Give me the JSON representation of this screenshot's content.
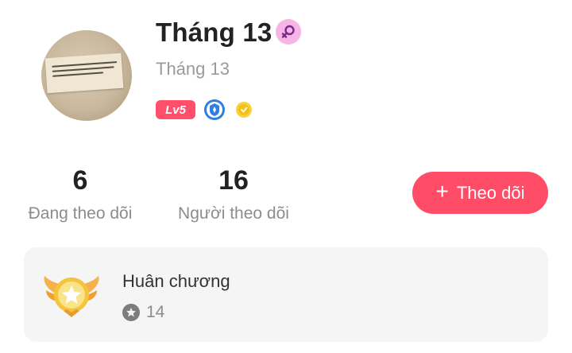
{
  "profile": {
    "display_name": "Tháng 13",
    "username": "Tháng 13",
    "gender_icon": "female-icon",
    "level_badge": "Lv5",
    "badges": [
      "shield-badge-icon",
      "gold-coin-badge-icon"
    ]
  },
  "stats": {
    "following_count": "6",
    "following_label": "Đang theo dõi",
    "followers_count": "16",
    "followers_label": "Người theo dõi"
  },
  "actions": {
    "follow_label": "Theo dõi",
    "follow_icon": "plus-icon"
  },
  "medals": {
    "title": "Huân chương",
    "count": "14",
    "icon": "winged-medal-icon"
  },
  "colors": {
    "accent": "#ff4d67",
    "gender_badge": "#f7b4e6",
    "card_bg": "#f5f5f5"
  }
}
